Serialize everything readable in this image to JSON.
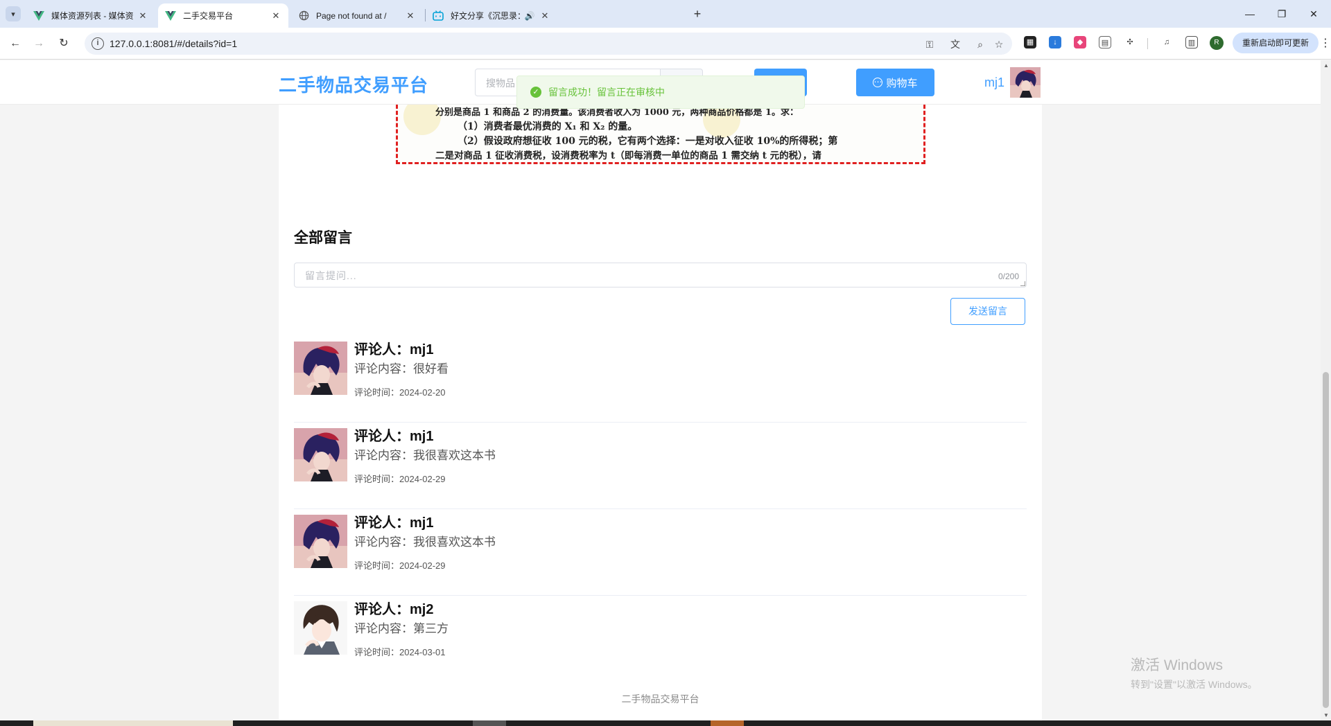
{
  "browser": {
    "tabs": [
      {
        "title": "媒体资源列表 - 媒体资源管理系",
        "favicon": "vue-icon",
        "active": false
      },
      {
        "title": "二手交易平台",
        "favicon": "vue-icon",
        "active": true
      },
      {
        "title": "Page not found at /",
        "favicon": "globe-icon",
        "active": false
      },
      {
        "title": "好文分享《沉思录：人生",
        "favicon": "bilibili-icon",
        "active": false,
        "audio": true
      }
    ],
    "url": "127.0.0.1:8081/#/details?id=1",
    "update_button": "重新启动即可更新",
    "profile_initial": "R"
  },
  "header": {
    "logo": "二手物品交易平台",
    "search_placeholder": "搜物品",
    "cart_label": "购物车",
    "username": "mj1"
  },
  "toast": {
    "message": "留言成功！留言正在审核中"
  },
  "document_image": {
    "lines": [
      "分别是商品 1 和商品 2 的消费量。该消费者收入为 1000 元，两种商品价格都是 1。求：",
      "（1）消费者最优消费的 X₁ 和 X₂ 的量。",
      "（2）假设政府想征收 100 元的税，它有两个选择：一是对收入征收 10%的所得税；第",
      "二是对商品 1 征收消费税，设消费税率为 t（即每消费一单位的商品 1 需交纳 t 元的税），请"
    ]
  },
  "comments_section": {
    "title": "全部留言",
    "input_placeholder": "留言提问...",
    "char_count": "0/200",
    "send_button": "发送留言",
    "comments": [
      {
        "author": "评论人：mj1",
        "content": "评论内容：很好看",
        "time": "评论时间：2024-02-20",
        "avatar": "anime-boy-red-avatar"
      },
      {
        "author": "评论人：mj1",
        "content": "评论内容：我很喜欢这本书",
        "time": "评论时间：2024-02-29",
        "avatar": "anime-boy-red-avatar"
      },
      {
        "author": "评论人：mj1",
        "content": "评论内容：我很喜欢这本书",
        "time": "评论时间：2024-02-29",
        "avatar": "anime-boy-red-avatar"
      },
      {
        "author": "评论人：mj2",
        "content": "评论内容：第三方",
        "time": "评论时间：2024-03-01",
        "avatar": "anime-boy-brown-avatar"
      }
    ]
  },
  "footer": {
    "text": "二手物品交易平台"
  },
  "os_watermark": {
    "line1": "激活 Windows",
    "line2": "转到\"设置\"以激活 Windows。"
  },
  "colors": {
    "primary": "#409eff",
    "success": "#67c23a",
    "danger_border": "#e02020"
  }
}
